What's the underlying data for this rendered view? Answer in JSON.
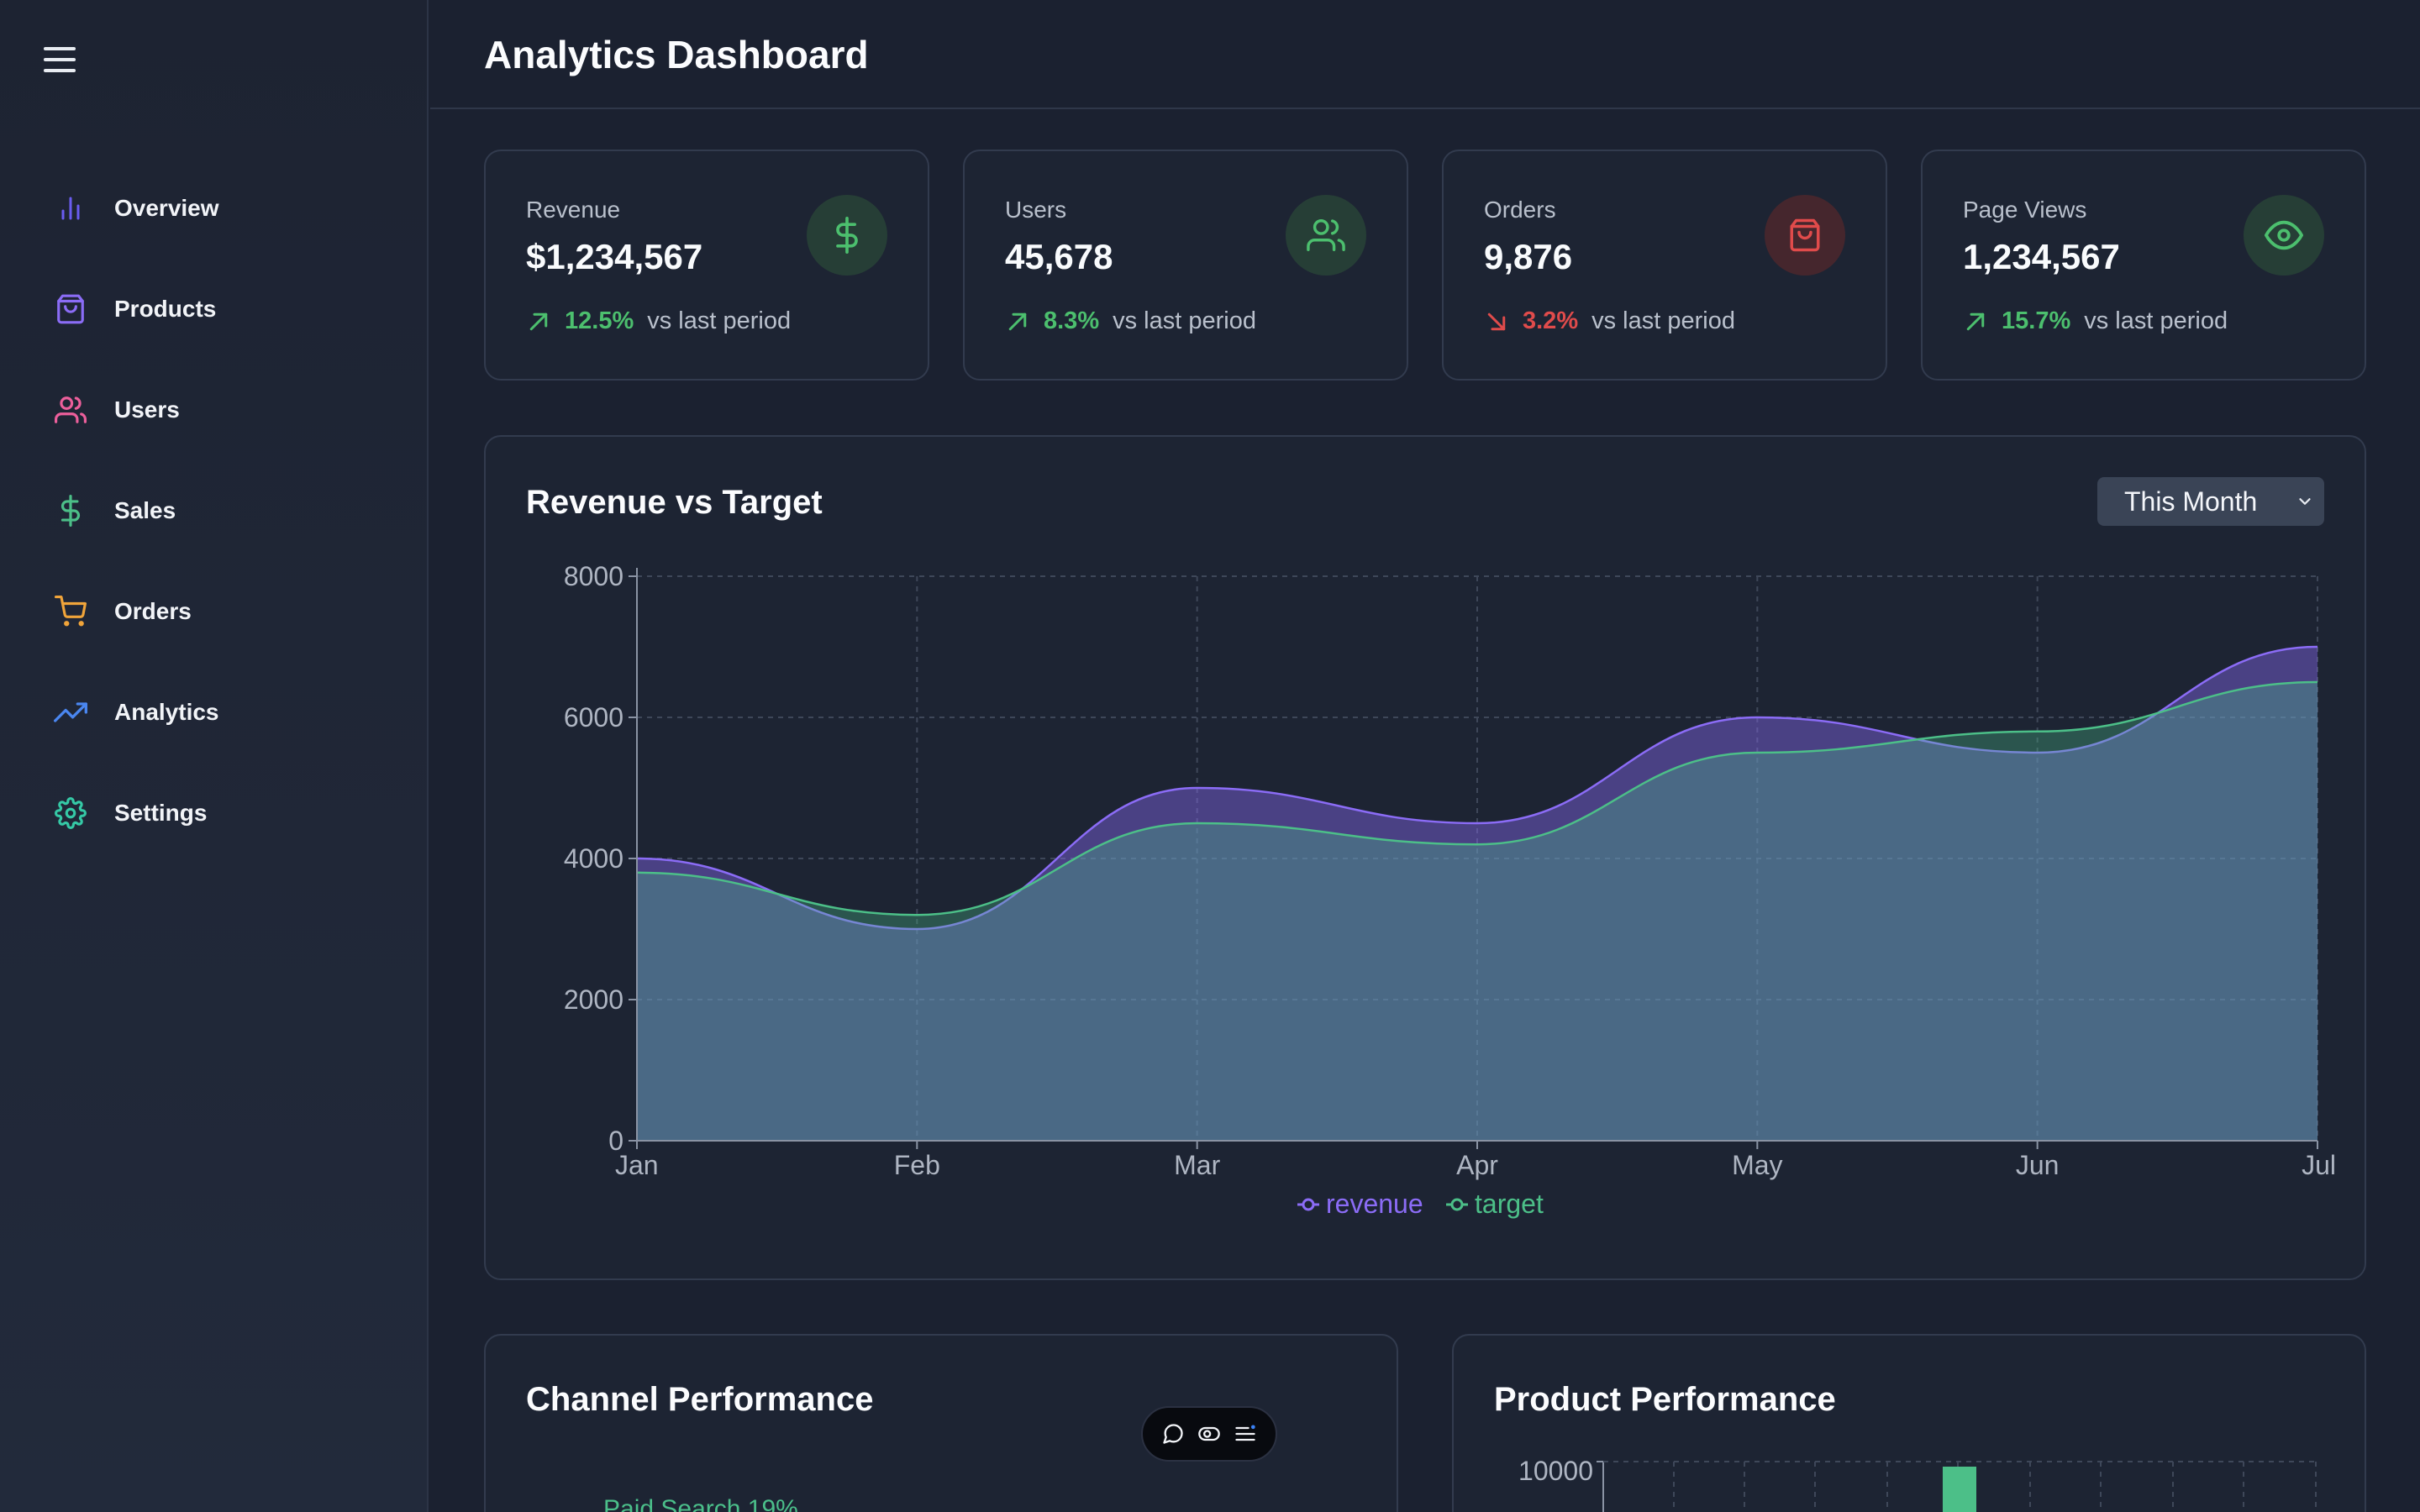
{
  "header": {
    "title": "Analytics Dashboard"
  },
  "sidebar": {
    "items": [
      {
        "label": "Overview",
        "icon": "bar-chart-icon",
        "color": "#6a5cf0"
      },
      {
        "label": "Products",
        "icon": "shopping-bag-icon",
        "color": "#8b6cf6"
      },
      {
        "label": "Users",
        "icon": "users-icon",
        "color": "#ec5f9b"
      },
      {
        "label": "Sales",
        "icon": "dollar-icon",
        "color": "#4cbf88"
      },
      {
        "label": "Orders",
        "icon": "cart-icon",
        "color": "#f0a43a"
      },
      {
        "label": "Analytics",
        "icon": "trending-up-icon",
        "color": "#4a86f0"
      },
      {
        "label": "Settings",
        "icon": "gear-icon",
        "color": "#35c9a6"
      }
    ]
  },
  "stats": [
    {
      "label": "Revenue",
      "value": "$1,234,567",
      "change": "12.5%",
      "trend": "up",
      "compare": "vs last period",
      "icon": "dollar-icon",
      "accent": "#4cbf6e"
    },
    {
      "label": "Users",
      "value": "45,678",
      "change": "8.3%",
      "trend": "up",
      "compare": "vs last period",
      "icon": "users-icon",
      "accent": "#4cbf6e"
    },
    {
      "label": "Orders",
      "value": "9,876",
      "change": "3.2%",
      "trend": "down",
      "compare": "vs last period",
      "icon": "shopping-bag-icon",
      "accent": "#e04b4b"
    },
    {
      "label": "Page Views",
      "value": "1,234,567",
      "change": "15.7%",
      "trend": "up",
      "compare": "vs last period",
      "icon": "eye-icon",
      "accent": "#4cbf6e"
    }
  ],
  "revenue_chart": {
    "title": "Revenue vs Target",
    "range_selected": "This Month"
  },
  "chart_data": {
    "type": "area",
    "x": [
      "Jan",
      "Feb",
      "Mar",
      "Apr",
      "May",
      "Jun",
      "Jul"
    ],
    "yticks": [
      0,
      2000,
      4000,
      6000,
      8000
    ],
    "ylim": [
      0,
      8000
    ],
    "grid": true,
    "legend": "bottom-center",
    "series": [
      {
        "name": "revenue",
        "values": [
          4000,
          3000,
          5000,
          4500,
          6000,
          5500,
          7000
        ],
        "color": "#8b6cf6"
      },
      {
        "name": "target",
        "values": [
          3800,
          3200,
          4500,
          4200,
          5500,
          5800,
          6500
        ],
        "color": "#4cbf88"
      }
    ]
  },
  "channel_performance": {
    "title": "Channel Performance",
    "visible_label": "Paid Search 19%"
  },
  "product_performance": {
    "title": "Product Performance",
    "top_tick": "10000"
  },
  "toolbar": {
    "buttons": [
      "comment-icon",
      "toggle-icon",
      "menu-list-icon"
    ]
  }
}
